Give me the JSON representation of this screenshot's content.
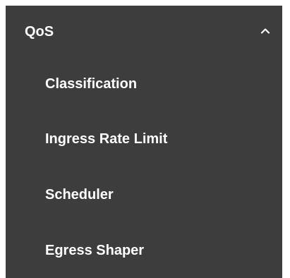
{
  "sidebar": {
    "section": {
      "label": "QoS",
      "expanded": true,
      "icon": "chevron-up-icon"
    },
    "items": [
      {
        "label": "Classification"
      },
      {
        "label": "Ingress Rate Limit"
      },
      {
        "label": "Scheduler"
      },
      {
        "label": "Egress Shaper"
      }
    ]
  },
  "colors": {
    "background": "#3d3d3d",
    "text": "#ffffff"
  }
}
